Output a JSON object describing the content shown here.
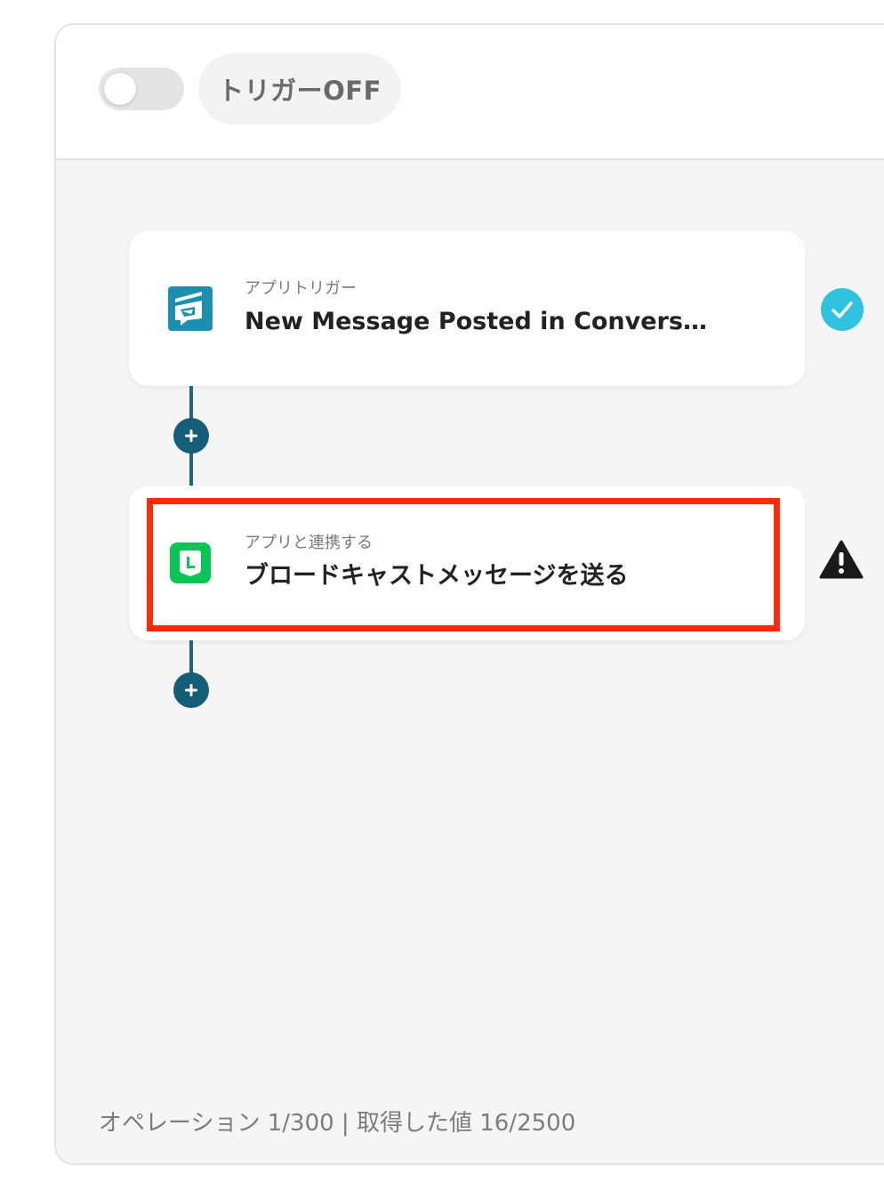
{
  "header": {
    "toggle_state": "off",
    "trigger_label": "トリガーOFF"
  },
  "flow": {
    "steps": [
      {
        "subtitle": "アプリトリガー",
        "title": "New Message Posted in Conversat…",
        "icon": "chat-app-icon",
        "icon_color": "#1a8fb0",
        "status": "check-icon",
        "status_color": "#2ec4e0"
      },
      {
        "subtitle": "アプリと連携する",
        "title": "ブロードキャストメッセージを送る",
        "icon": "line-icon",
        "icon_color": "#06c755",
        "status": "warning-icon",
        "status_color": "#1a1a1a"
      }
    ]
  },
  "footer": {
    "usage": "オペレーション 1/300 | 取得した値 16/2500"
  },
  "colors": {
    "accent": "#145e7a",
    "highlight": "#ff2a0b"
  }
}
